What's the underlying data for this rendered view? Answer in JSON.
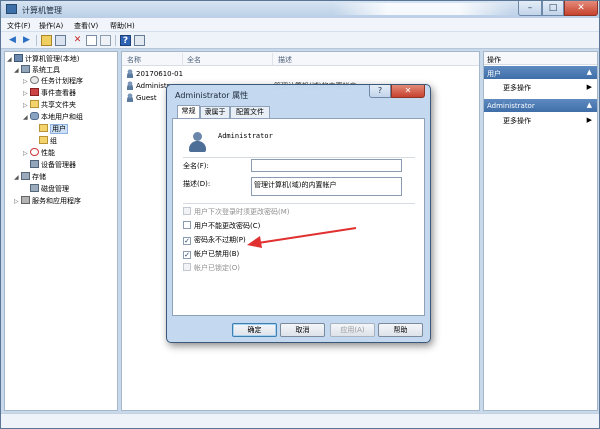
{
  "window": {
    "title": "计算机管理",
    "controls": {
      "minimize": "–",
      "maximize": "□",
      "close": "✕"
    }
  },
  "menu": [
    "文件(F)",
    "操作(A)",
    "查看(V)",
    "帮助(H)"
  ],
  "toolbar": {
    "icons": [
      "back-arrow-icon",
      "forward-arrow-icon",
      "up-folder-icon",
      "show-tree-icon",
      "delete-icon",
      "properties-icon",
      "refresh-icon",
      "help-icon",
      "console-icon"
    ]
  },
  "tree": {
    "root": "计算机管理(本地)",
    "system_tools": "系统工具",
    "task_scheduler": "任务计划程序",
    "event_viewer": "事件查看器",
    "shared_folders": "共享文件夹",
    "local_users": "本地用户和组",
    "users": "用户",
    "groups": "组",
    "performance": "性能",
    "device_manager": "设备管理器",
    "storage": "存储",
    "disk_management": "磁盘管理",
    "services": "服务和应用程序"
  },
  "list": {
    "columns": [
      "名称",
      "全名",
      "描述"
    ],
    "rows": [
      {
        "name": "20170610-01",
        "fullname": "",
        "desc": ""
      },
      {
        "name": "Administr...",
        "fullname": "",
        "desc": "管理计算机(域)的内置帐户"
      },
      {
        "name": "Guest",
        "fullname": "",
        "desc": ""
      }
    ]
  },
  "actions": {
    "title": "操作",
    "section1": "用户",
    "section1_item": "更多操作",
    "section2": "Administrator",
    "section2_item": "更多操作"
  },
  "dialog": {
    "title": "Administrator 属性",
    "tabs": [
      "常规",
      "隶属于",
      "配置文件"
    ],
    "username": "Administrator",
    "fullname_label": "全名(F):",
    "fullname_value": "",
    "desc_label": "描述(D):",
    "desc_value": "管理计算机(域)的内置帐户",
    "checkboxes": [
      {
        "label": "用户下次登录时须更改密码(M)",
        "checked": false,
        "disabled": true
      },
      {
        "label": "用户不能更改密码(C)",
        "checked": false,
        "disabled": false
      },
      {
        "label": "密码永不过期(P)",
        "checked": true,
        "disabled": false
      },
      {
        "label": "帐户已禁用(B)",
        "checked": true,
        "disabled": false
      },
      {
        "label": "帐户已锁定(O)",
        "checked": false,
        "disabled": true
      }
    ],
    "buttons": {
      "ok": "确定",
      "cancel": "取消",
      "apply": "应用(A)",
      "help": "帮助"
    }
  },
  "annotation": {
    "arrow_color": "#e03030"
  }
}
